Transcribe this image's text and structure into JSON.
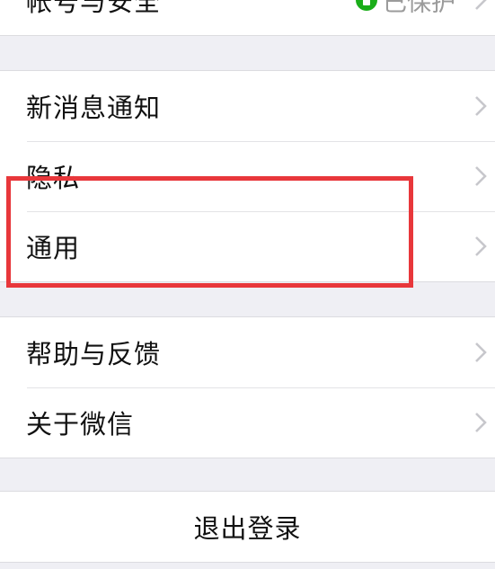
{
  "account": {
    "label": "帐号与安全",
    "status": "已保护",
    "status_icon": "lock-icon",
    "status_color": "#1aad19"
  },
  "settings_group": {
    "items": [
      {
        "label": "新消息通知"
      },
      {
        "label": "隐私"
      },
      {
        "label": "通用"
      }
    ]
  },
  "info_group": {
    "items": [
      {
        "label": "帮助与反馈"
      },
      {
        "label": "关于微信"
      }
    ]
  },
  "logout": {
    "label": "退出登录"
  },
  "highlight": {
    "target": "通用",
    "color": "#e8373b"
  },
  "colors": {
    "background": "#efeff4",
    "cell": "#ffffff",
    "text": "#111111",
    "secondary_text": "#9b9b9b",
    "chevron": "#c7c7cc"
  }
}
